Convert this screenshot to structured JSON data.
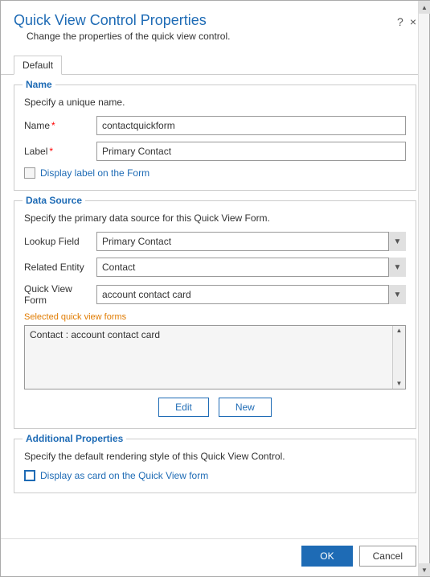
{
  "dialog": {
    "title": "Quick View Control Properties",
    "help_icon": "?",
    "close_icon": "×",
    "subtitle": "Change the properties of the quick view control."
  },
  "tabs": [
    {
      "label": "Default",
      "active": true
    }
  ],
  "name_group": {
    "legend": "Name",
    "description": "Specify a unique name.",
    "name_label": "Name",
    "name_required": true,
    "name_value": "contactquickform",
    "label_label": "Label",
    "label_required": true,
    "label_value": "Primary Contact",
    "checkbox_label": "Display label on the Form"
  },
  "datasource_group": {
    "legend": "Data Source",
    "description": "Specify the primary data source for this Quick View Form.",
    "lookup_field_label": "Lookup Field",
    "lookup_field_value": "Primary Contact",
    "related_entity_label": "Related Entity",
    "related_entity_value": "Contact",
    "quick_view_form_label": "Quick View Form",
    "quick_view_form_value": "account contact card",
    "selected_forms_label": "Selected quick view forms",
    "selected_forms_items": [
      "Contact : account contact card"
    ],
    "edit_button": "Edit",
    "new_button": "New"
  },
  "additional_group": {
    "legend": "Additional Properties",
    "description": "Specify the default rendering style of this Quick View Control.",
    "checkbox_label": "Display as card on the Quick View form"
  },
  "footer": {
    "ok_label": "OK",
    "cancel_label": "Cancel"
  }
}
